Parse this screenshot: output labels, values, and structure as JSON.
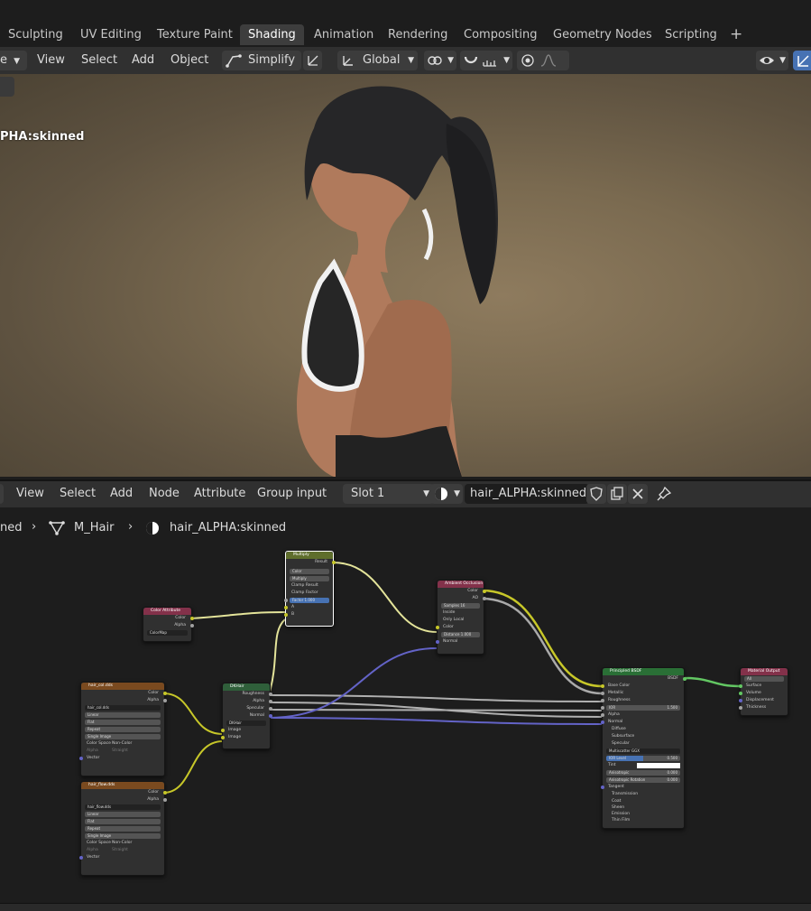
{
  "workspace_tabs": [
    "Sculpting",
    "UV Editing",
    "Texture Paint",
    "Shading",
    "Animation",
    "Rendering",
    "Compositing",
    "Geometry Nodes",
    "Scripting"
  ],
  "workspace_active": "Shading",
  "viewport_header": {
    "mode_fragment": "e",
    "menus": [
      "View",
      "Select",
      "Add",
      "Object"
    ],
    "simplify_label": "Simplify",
    "transform_orientation": "Global"
  },
  "viewport": {
    "object_label": "PHA:skinned"
  },
  "node_header": {
    "menus": [
      "View",
      "Select",
      "Add",
      "Node",
      "Attribute",
      "Group input"
    ],
    "slot": "Slot 1",
    "material_name": "hair_ALPHA:skinned"
  },
  "breadcrumb": {
    "first": "ned",
    "object": "M_Hair",
    "material": "hair_ALPHA:skinned"
  },
  "nodes": {
    "color_attribute": {
      "title": "Color Attribute",
      "out_color": "Color",
      "out_alpha": "Alpha",
      "layer": "ColorMap"
    },
    "multiply": {
      "title": "Multiply",
      "result": "Result",
      "mode1": "Color",
      "mode2": "Multiply",
      "clamp_result": "Clamp Result",
      "clamp_factor": "Clamp Factor",
      "factor_label": "Factor",
      "factor_value": "1.000",
      "in_a": "A",
      "in_b": "B"
    },
    "ao": {
      "title": "Ambient Occlusion",
      "out_color": "Color",
      "out_ao": "AO",
      "samples_label": "Samples",
      "samples_value": "16",
      "inside": "Inside",
      "only_local": "Only Local",
      "in_color": "Color",
      "distance_label": "Distance",
      "distance_value": "1.000",
      "in_normal": "Normal"
    },
    "hair_col": {
      "title": "hair_col.dds",
      "out_color": "Color",
      "out_alpha": "Alpha",
      "image": "hair_col.dds",
      "interp": "Linear",
      "proj": "Flat",
      "ext": "Repeat",
      "src": "Single Image",
      "cs_label": "Color Space",
      "cs_value": "Non-Color",
      "alpha_label": "Alpha",
      "alpha_value": "Straight",
      "in_vector": "Vector"
    },
    "hair_flow": {
      "title": "hair_flow.dds",
      "out_color": "Color",
      "out_alpha": "Alpha",
      "image": "hair_flow.dds",
      "interp": "Linear",
      "proj": "Flat",
      "ext": "Repeat",
      "src": "Single Image",
      "cs_label": "Color Space",
      "cs_value": "Non-Color",
      "alpha_label": "Alpha",
      "alpha_value": "Straight",
      "in_vector": "Vector"
    },
    "hair_group": {
      "title": "DKHair",
      "roughness": "Roughness",
      "alpha": "Alpha",
      "specular": "Specular",
      "normal": "Normal",
      "group": "DKHair",
      "image1": "Image",
      "image2": "Image"
    },
    "bsdf": {
      "title": "Principled BSDF",
      "out": "BSDF",
      "base_color": "Base Color",
      "metallic": "Metallic",
      "roughness": "Roughness",
      "ior_label": "IOR",
      "ior_value": "1.500",
      "alpha": "Alpha",
      "normal": "Normal",
      "diffuse": "Diffuse",
      "subsurface": "Subsurface",
      "specular": "Specular",
      "ms": "Multiscatter GGX",
      "ior_level_label": "IOR Level",
      "ior_level_value": "0.500",
      "tint": "Tint",
      "aniso_label": "Anisotropic",
      "aniso_value": "0.000",
      "aniso_rot_label": "Anisotropic Rotation",
      "aniso_rot_value": "0.000",
      "tangent": "Tangent",
      "transmission": "Transmission",
      "coat": "Coat",
      "sheen": "Sheen",
      "emission": "Emission",
      "thin_film": "Thin Film"
    },
    "output": {
      "title": "Material Output",
      "target": "All",
      "surface": "Surface",
      "volume": "Volume",
      "displacement": "Displacement",
      "thickness": "Thickness"
    }
  },
  "colors": {
    "accent": "#4772b3",
    "active_tab": "#3d3d3d",
    "header": "#303030",
    "socket_color": "#c7c729",
    "socket_float": "#a1a1a1",
    "socket_vector": "#6363c7",
    "socket_shader": "#63c763"
  }
}
